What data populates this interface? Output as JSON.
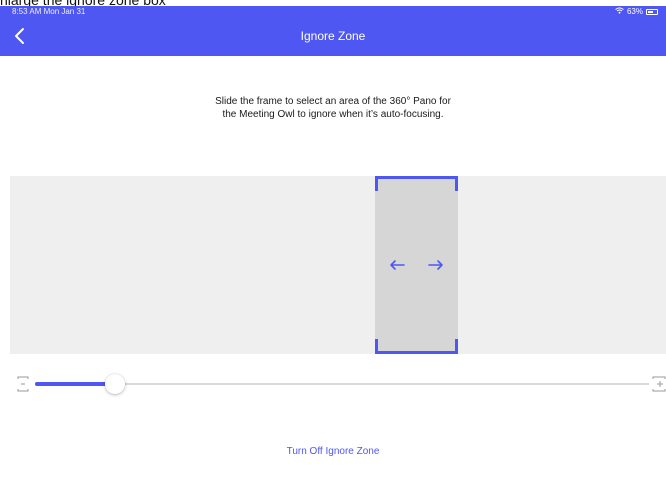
{
  "top_note": "nlarge the ignore zone box",
  "status_bar": {
    "time": "8:53 AM  Mon Jan 31",
    "battery_text": "63%",
    "battery_level": 0.63
  },
  "header": {
    "title": "Ignore Zone",
    "back_icon": "chevron-left-icon",
    "background_color": "#4f57f2"
  },
  "instruction": {
    "text": "Slide the frame to select an area of the 360° Pano for the Meeting Owl to ignore when it’s auto-focusing."
  },
  "zone": {
    "arrow_left_icon": "arrow-left-icon",
    "arrow_right_icon": "arrow-right-icon",
    "accent_color": "#4f57f2"
  },
  "size_slider": {
    "value": 0.13,
    "min_icon": "shrink-icon",
    "max_icon": "expand-icon"
  },
  "footer": {
    "turn_off_label": "Turn Off Ignore Zone"
  }
}
